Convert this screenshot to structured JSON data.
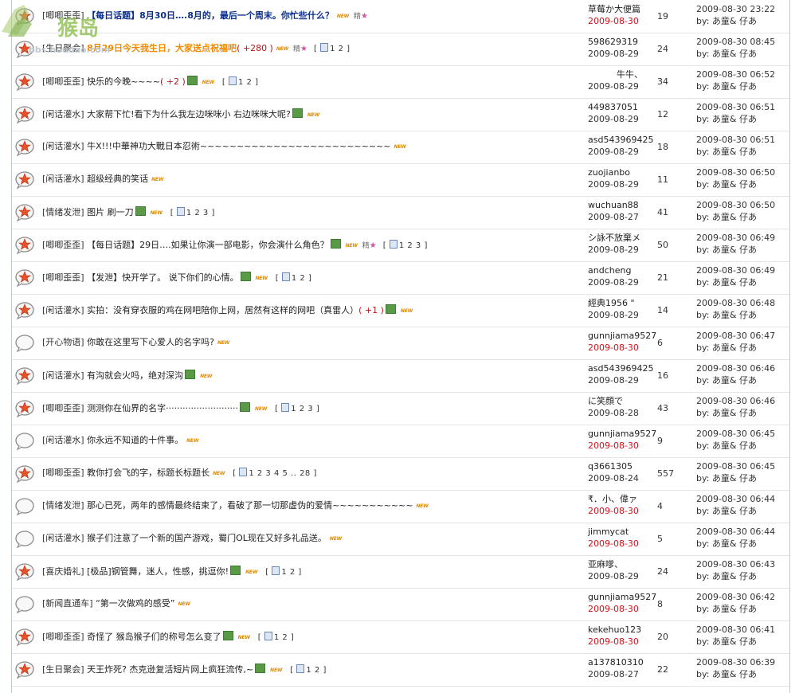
{
  "watermark": {
    "site": "猴岛",
    "url": "bbs.houdao.com"
  },
  "threads": [
    {
      "icon": "hot",
      "cat": "[唧唧歪歪]",
      "subject": "【每日话题】8月30日….8月的，最后一个周末。你忙些什么？",
      "style": "blue",
      "rate": "",
      "pic": false,
      "new": true,
      "jing": true,
      "pages": "",
      "author": "草莓か大便篇",
      "date": "2009-08-30",
      "date_red": true,
      "count": "19",
      "last_time": "2009-08-30 23:22",
      "last_by": "by: あ童& 仔あ"
    },
    {
      "icon": "hot",
      "cat": "[生日聚会]",
      "subject": "8月29日今天我生日，大家送点祝福吧",
      "style": "orange",
      "rate": "( +280 )",
      "pic": false,
      "new": true,
      "jing": true,
      "pages": "1 2",
      "author": "598629319",
      "date": "2009-08-29",
      "date_red": false,
      "count": "24",
      "last_time": "2009-08-30 08:45",
      "last_by": "by: あ童& 仔あ"
    },
    {
      "icon": "hot",
      "cat": "[唧唧歪歪]",
      "subject": "快乐的今晚~~~~",
      "style": "",
      "rate": "( +2 )",
      "pic": true,
      "new": true,
      "jing": false,
      "pages": "1 2",
      "author": "牛牛、",
      "date": "2009-08-29",
      "date_red": false,
      "count": "34",
      "last_time": "2009-08-30 06:52",
      "last_by": "by: あ童& 仔あ",
      "indent": true
    },
    {
      "icon": "hot",
      "cat": "[闲话灌水]",
      "subject": "大家帮下忙!看下为什么我左边咪咪小  右边咪咪大呢?",
      "style": "",
      "rate": "",
      "pic": true,
      "new": true,
      "jing": false,
      "pages": "",
      "author": "449837051",
      "date": "2009-08-29",
      "date_red": false,
      "count": "12",
      "last_time": "2009-08-30 06:51",
      "last_by": "by: あ童& 仔あ"
    },
    {
      "icon": "hot",
      "cat": "[闲话灌水]",
      "subject": "牛X!!!中華神功大戰日本忍術~~~~~~~~~~~~~~~~~~~~~~~~~~",
      "style": "",
      "rate": "",
      "pic": false,
      "new": true,
      "jing": false,
      "pages": "",
      "author": "asd543969425",
      "date": "2009-08-29",
      "date_red": false,
      "count": "18",
      "last_time": "2009-08-30 06:51",
      "last_by": "by: あ童& 仔あ"
    },
    {
      "icon": "hot",
      "cat": "[闲话灌水]",
      "subject": "超级经典的笑话",
      "style": "",
      "rate": "",
      "pic": false,
      "new": true,
      "jing": false,
      "pages": "",
      "author": "zuojianbo",
      "date": "2009-08-29",
      "date_red": false,
      "count": "11",
      "last_time": "2009-08-30 06:50",
      "last_by": "by: あ童& 仔あ"
    },
    {
      "icon": "hot",
      "cat": "[情绪发泄]",
      "subject": "图片  刷一刀",
      "style": "",
      "rate": "",
      "pic": true,
      "new": true,
      "jing": false,
      "pages": "1 2 3",
      "author": "wuchuan88",
      "date": "2009-08-27",
      "date_red": false,
      "count": "41",
      "last_time": "2009-08-30 06:50",
      "last_by": "by: あ童& 仔あ"
    },
    {
      "icon": "hot",
      "cat": "[唧唧歪歪]",
      "subject": "【每日话题】29日….如果让你演一部电影，你会演什么角色？",
      "style": "",
      "rate": "",
      "pic": true,
      "new": true,
      "jing": true,
      "pages": "1 2 3",
      "author": "シ詠不放棄メ",
      "date": "2009-08-29",
      "date_red": false,
      "count": "50",
      "last_time": "2009-08-30 06:49",
      "last_by": "by: あ童& 仔あ"
    },
    {
      "icon": "hot",
      "cat": "[唧唧歪歪]",
      "subject": "【发泄】快开学了。  说下你们的心情。",
      "style": "",
      "rate": "",
      "pic": true,
      "new": true,
      "jing": false,
      "pages": "1 2",
      "author": "andcheng",
      "date": "2009-08-29",
      "date_red": false,
      "count": "21",
      "last_time": "2009-08-30 06:49",
      "last_by": "by: あ童& 仔あ"
    },
    {
      "icon": "hot",
      "cat": "[闲话灌水]",
      "subject": "实拍：没有穿衣服的鸡在网吧陪你上网，居然有这样的网吧（真雷人）",
      "style": "",
      "rate": "( +1 )",
      "pic": true,
      "new": true,
      "jing": false,
      "pages": "",
      "author": "經典1956 \"",
      "date": "2009-08-29",
      "date_red": false,
      "count": "14",
      "last_time": "2009-08-30 06:48",
      "last_by": "by: あ童& 仔あ"
    },
    {
      "icon": "plain",
      "cat": "[开心物语]",
      "subject": "你敢在这里写下心爱人的名字吗?",
      "style": "",
      "rate": "",
      "pic": false,
      "new": true,
      "jing": false,
      "pages": "",
      "author": "gunnjiama9527",
      "date": "2009-08-30",
      "date_red": true,
      "count": "6",
      "last_time": "2009-08-30 06:47",
      "last_by": "by: あ童& 仔あ"
    },
    {
      "icon": "hot",
      "cat": "[闲话灌水]",
      "subject": "有沟就会火吗，绝对深沟",
      "style": "",
      "rate": "",
      "pic": true,
      "new": true,
      "jing": false,
      "pages": "",
      "author": "asd543969425",
      "date": "2009-08-29",
      "date_red": false,
      "count": "16",
      "last_time": "2009-08-30 06:46",
      "last_by": "by: あ童& 仔あ"
    },
    {
      "icon": "hot",
      "cat": "[唧唧歪歪]",
      "subject": "测测你在仙界的名字··························",
      "style": "",
      "rate": "",
      "pic": true,
      "new": true,
      "jing": false,
      "pages": "1 2 3",
      "author": "に笑顔で",
      "date": "2009-08-28",
      "date_red": false,
      "count": "43",
      "last_time": "2009-08-30 06:46",
      "last_by": "by: あ童& 仔あ"
    },
    {
      "icon": "plain",
      "cat": "[闲话灌水]",
      "subject": "你永远不知道的十件事。",
      "style": "",
      "rate": "",
      "pic": false,
      "new": true,
      "jing": false,
      "pages": "",
      "author": "gunnjiama9527",
      "date": "2009-08-30",
      "date_red": true,
      "count": "9",
      "last_time": "2009-08-30 06:45",
      "last_by": "by: あ童& 仔あ"
    },
    {
      "icon": "hot",
      "cat": "[唧唧歪歪]",
      "subject": "教你打会飞的字，标题长标题长",
      "style": "",
      "rate": "",
      "pic": false,
      "new": true,
      "jing": false,
      "pages": "1 2 3 4 5 .. 28",
      "author": "q3661305",
      "date": "2009-08-24",
      "date_red": false,
      "count": "557",
      "last_time": "2009-08-30 06:45",
      "last_by": "by: あ童& 仔あ"
    },
    {
      "icon": "plain",
      "cat": "[情绪发泄]",
      "subject": "那心已死，两年的感情最终结束了，看破了那一切那虚伪的爱情~~~~~~~~~~~",
      "style": "",
      "rate": "",
      "pic": false,
      "new": true,
      "jing": false,
      "pages": "",
      "author": "₹．小、偉ァ",
      "date": "2009-08-30",
      "date_red": true,
      "count": "4",
      "last_time": "2009-08-30 06:44",
      "last_by": "by: あ童& 仔あ"
    },
    {
      "icon": "plain",
      "cat": "[闲话灌水]",
      "subject": "猴子们注意了一个新的国产游戏，蜀门OL现在又好多礼品送。",
      "style": "",
      "rate": "",
      "pic": false,
      "new": true,
      "jing": false,
      "pages": "",
      "author": "jimmycat",
      "date": "2009-08-30",
      "date_red": true,
      "count": "5",
      "last_time": "2009-08-30 06:44",
      "last_by": "by: あ童& 仔あ"
    },
    {
      "icon": "hot",
      "cat": "[喜庆婚礼]",
      "subject": "[极品]钢管舞，迷人，性感，挑逗你!",
      "style": "",
      "rate": "",
      "pic": true,
      "new": true,
      "jing": false,
      "pages": "1 2",
      "author": "亚麻嗲、",
      "date": "2009-08-29",
      "date_red": false,
      "count": "24",
      "last_time": "2009-08-30 06:43",
      "last_by": "by: あ童& 仔あ"
    },
    {
      "icon": "plain",
      "cat": "[新闻直通车]",
      "subject": "“第一次做鸡的感受”",
      "style": "",
      "rate": "",
      "pic": false,
      "new": true,
      "jing": false,
      "pages": "",
      "author": "gunnjiama9527",
      "date": "2009-08-30",
      "date_red": true,
      "count": "8",
      "last_time": "2009-08-30 06:42",
      "last_by": "by: あ童& 仔あ"
    },
    {
      "icon": "hot",
      "cat": "[唧唧歪歪]",
      "subject": "奇怪了  猴岛猴子们的称号怎么变了",
      "style": "",
      "rate": "",
      "pic": true,
      "new": true,
      "jing": false,
      "pages": "1 2",
      "author": "kekehuo123",
      "date": "2009-08-30",
      "date_red": true,
      "count": "20",
      "last_time": "2009-08-30 06:41",
      "last_by": "by: あ童& 仔あ"
    },
    {
      "icon": "hot",
      "cat": "[生日聚会]",
      "subject": "天王炸死? 杰克逊复活短片网上疯狂流传,~",
      "style": "",
      "rate": "",
      "pic": true,
      "new": true,
      "jing": false,
      "pages": "1 2",
      "author": "a137810310",
      "date": "2009-08-27",
      "date_red": false,
      "count": "22",
      "last_time": "2009-08-30 06:39",
      "last_by": "by: あ童& 仔あ"
    }
  ],
  "labels": {
    "new_badge": "NEW",
    "jing_badge": "精"
  }
}
